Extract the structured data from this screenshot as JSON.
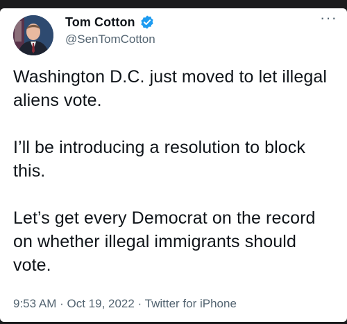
{
  "author": {
    "display_name": "Tom Cotton",
    "handle": "@SenTomCotton",
    "verified": true,
    "avatar": "portrait-avatar"
  },
  "menu": {
    "icon": "more-options-icon",
    "glyph": "···"
  },
  "tweet": {
    "paragraphs": [
      "Washington D.C. just moved to let illegal aliens vote.",
      "I’ll be introducing a resolution to block this.",
      "Let’s get every Democrat on the record on whether illegal immigrants should vote."
    ]
  },
  "meta": {
    "time": "9:53 AM",
    "separator": " · ",
    "date": "Oct 19, 2022",
    "source": "Twitter for iPhone"
  },
  "colors": {
    "text_primary": "#0f1419",
    "text_secondary": "#536471",
    "verified_blue": "#1d9bf0",
    "frame": "#1b1b1d"
  }
}
